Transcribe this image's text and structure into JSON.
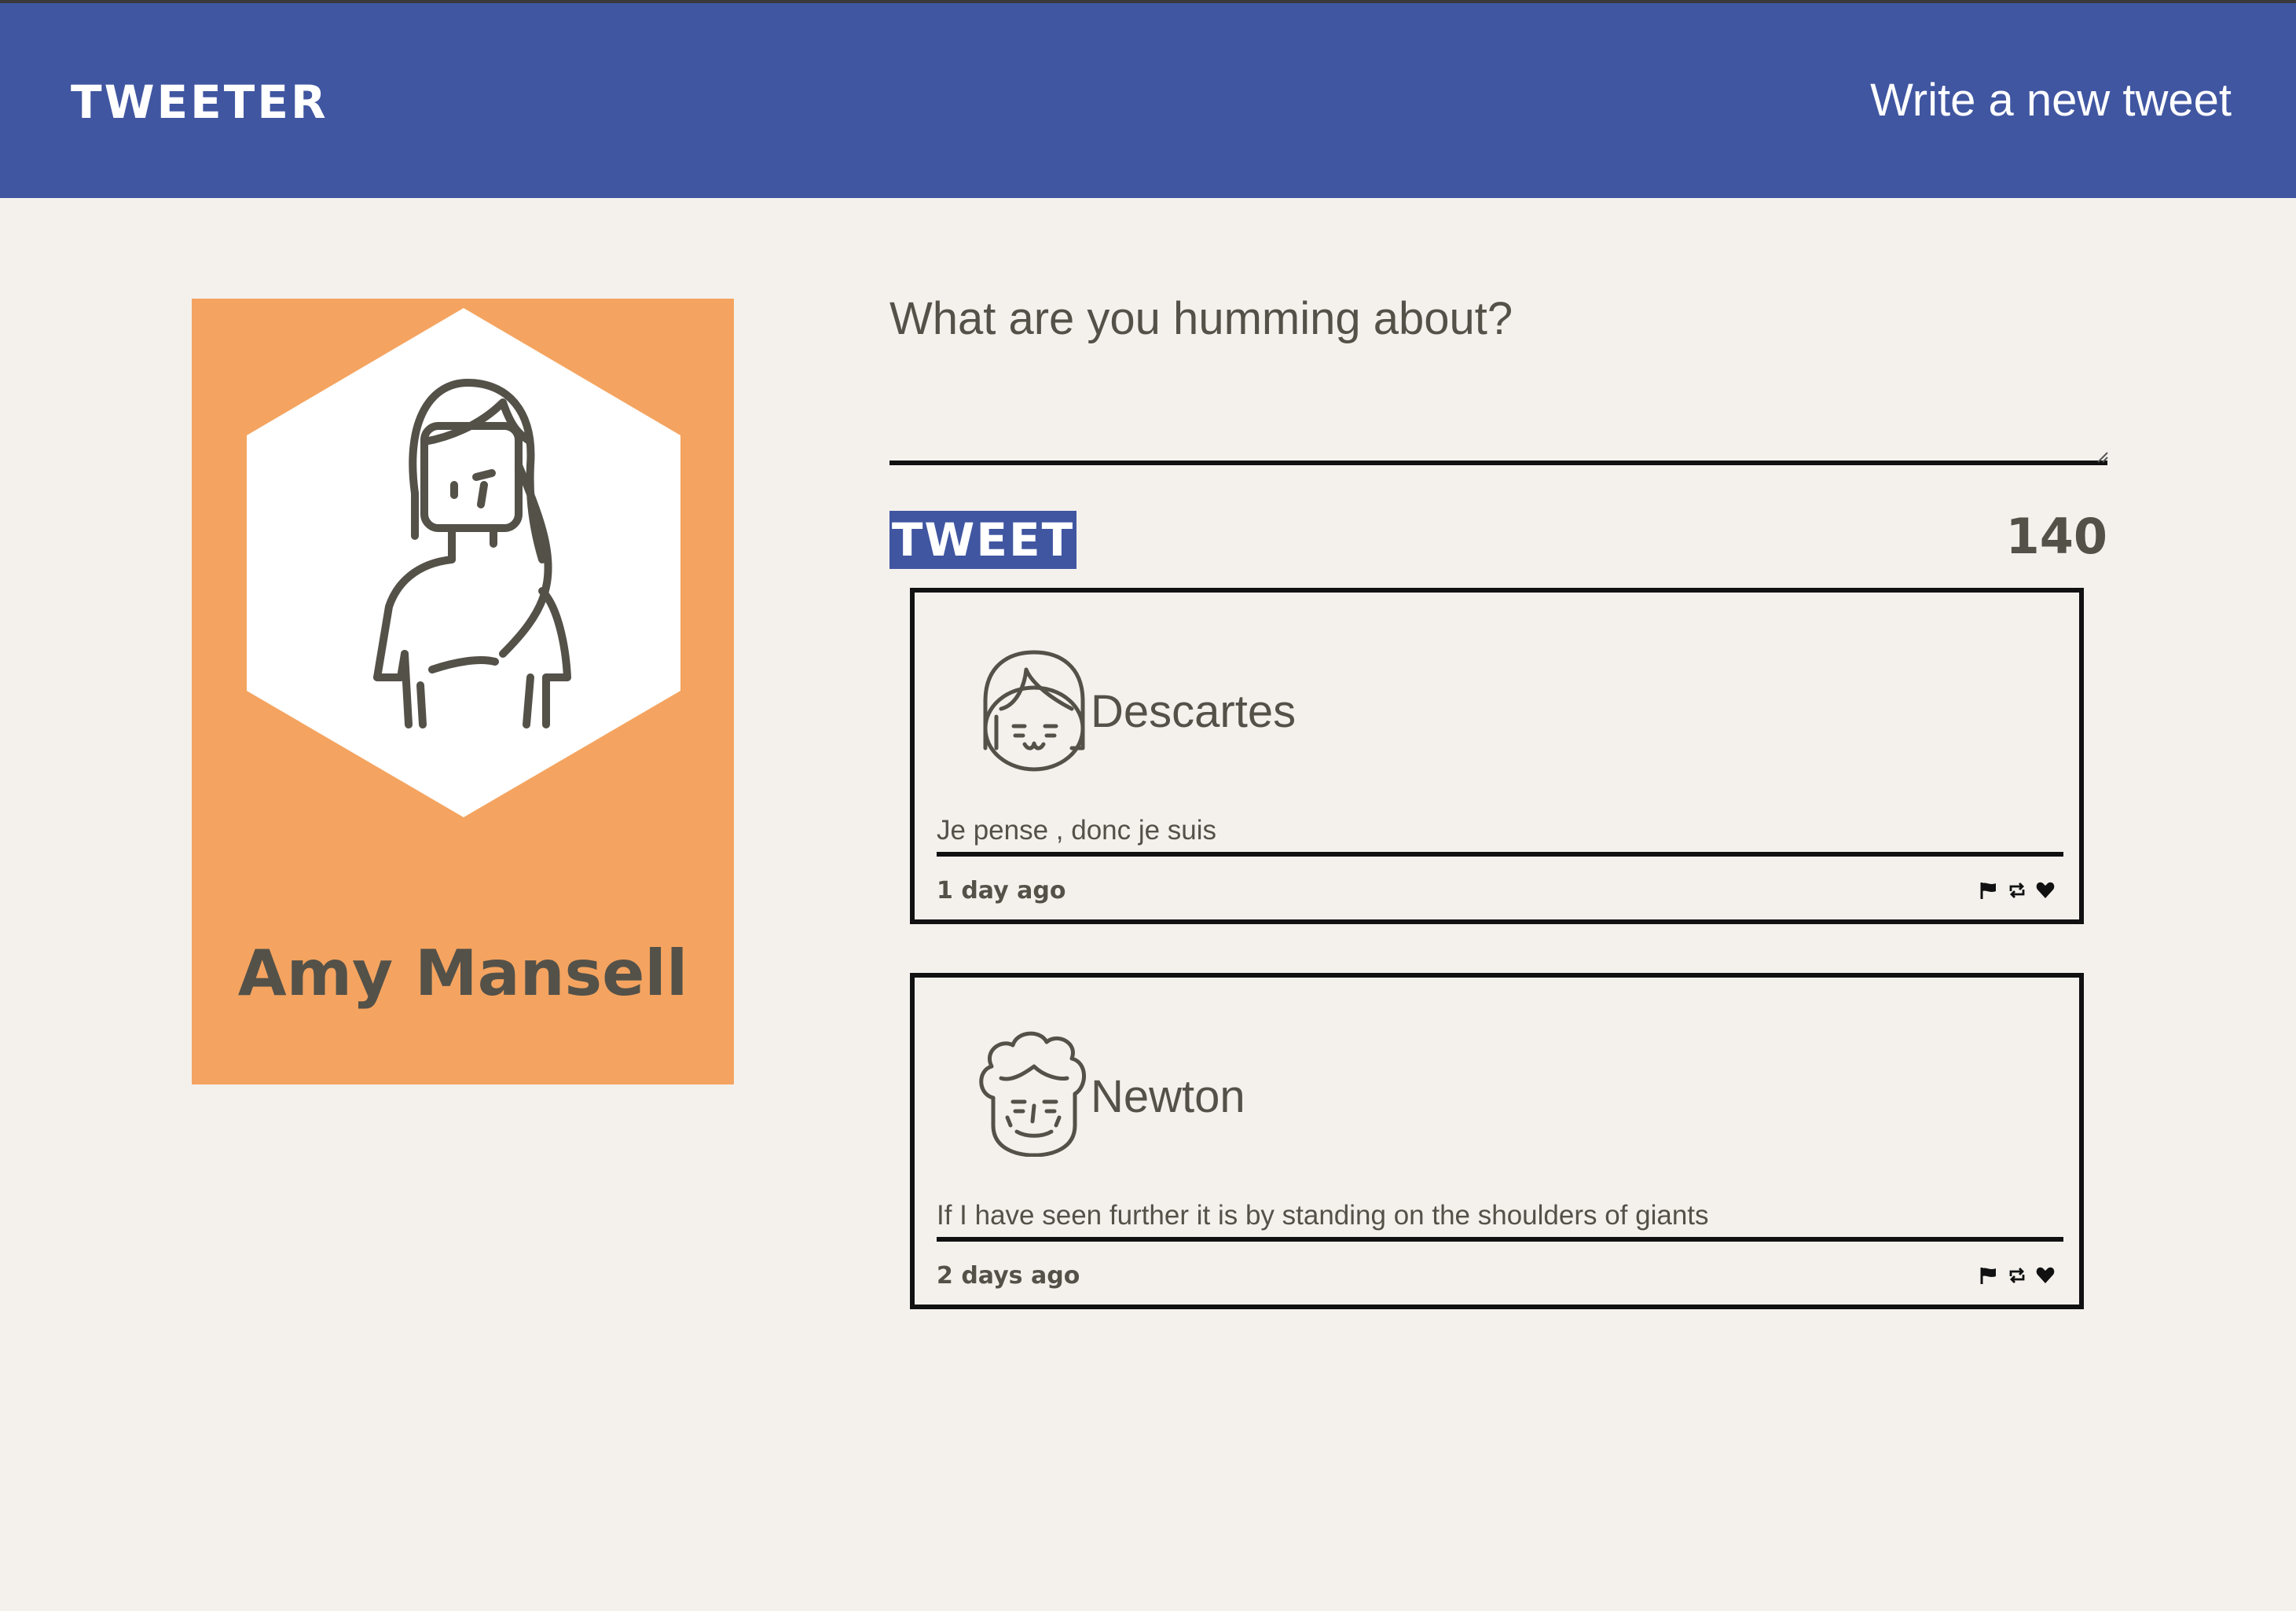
{
  "nav": {
    "brand": "TWEETER",
    "compose_link": "Write a new tweet"
  },
  "profile": {
    "name": "Amy Mansell",
    "avatar_icon": "person-avatar-icon",
    "card_color": "#f4a460"
  },
  "composer": {
    "placeholder": "What are you humming about?",
    "value": "",
    "submit_label": "TWEET",
    "counter": "140"
  },
  "tweets": [
    {
      "author": "Descartes",
      "avatar_icon": "girl-face-icon",
      "text": "Je pense , donc je suis",
      "age": "1 day ago",
      "actions": [
        "flag-icon",
        "retweet-icon",
        "heart-icon"
      ]
    },
    {
      "author": "Newton",
      "avatar_icon": "curly-hair-face-icon",
      "text": "If I have seen further it is by standing on the shoulders of giants",
      "age": "2 days ago",
      "actions": [
        "flag-icon",
        "retweet-icon",
        "heart-icon"
      ]
    }
  ],
  "colors": {
    "nav_bg": "#4056a1",
    "page_bg": "#f4f1ed",
    "text": "#545149"
  }
}
